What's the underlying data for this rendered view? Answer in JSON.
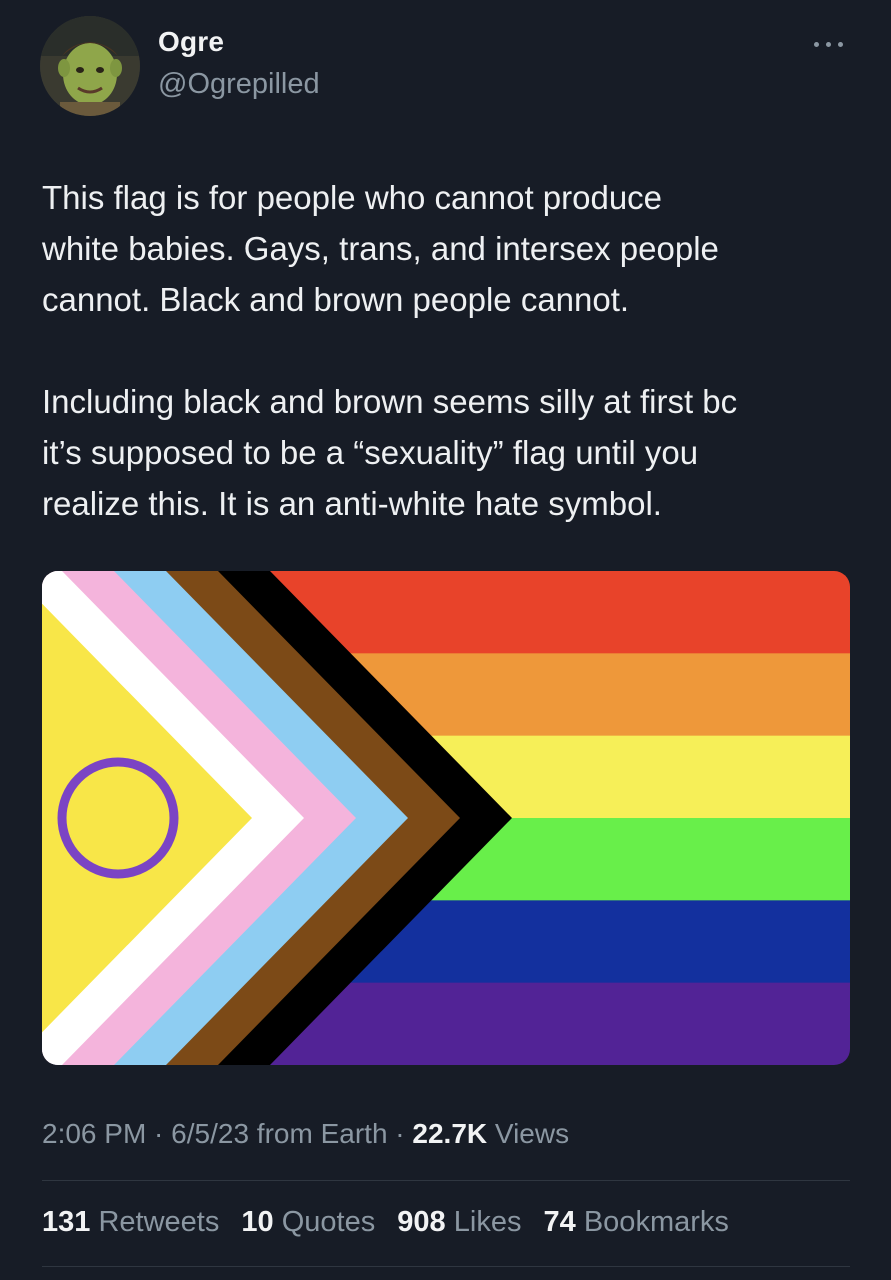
{
  "author": {
    "display_name": "Ogre",
    "handle": "@Ogrepilled",
    "avatar_icon": "ogre-avatar"
  },
  "menu_icon": "more-dots-icon",
  "tweet": {
    "paragraph_1": "This flag is for people who cannot produce\nwhite babies. Gays, trans, and intersex people\ncannot. Black and brown people cannot.",
    "paragraph_2": "Including black and brown seems silly at first bc\nit’s supposed to be a “sexuality” flag until you\nrealize this. It is an anti-white hate symbol."
  },
  "media": {
    "kind": "intersex-inclusive progress pride flag",
    "stripe_colors": [
      "#e8432a",
      "#ee983a",
      "#f6ef58",
      "#68ef4a",
      "#13309e",
      "#522396"
    ],
    "chevron_colors": [
      "#000000",
      "#7c4a17",
      "#8ecdf2",
      "#f4b4dc",
      "#ffffff"
    ],
    "field_color": "#f8e648",
    "ring_color": "#7b44c4"
  },
  "meta": {
    "time": "2:06 PM",
    "sep1": " · ",
    "date": "6/5/23",
    "source": " from Earth",
    "sep2": " · ",
    "views_count": "22.7K",
    "views_label": " Views"
  },
  "stats": {
    "retweets_count": "131",
    "retweets_label": " Retweets",
    "quotes_count": "10",
    "quotes_label": " Quotes",
    "likes_count": "908",
    "likes_label": " Likes",
    "bookmarks_count": "74",
    "bookmarks_label": " Bookmarks"
  }
}
